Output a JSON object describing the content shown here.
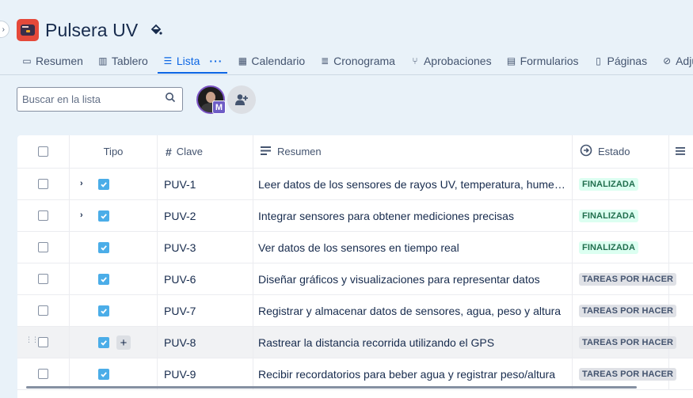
{
  "project": {
    "title": "Pulsera UV",
    "icon": "project-avatar-icon",
    "accent": "#e5493a"
  },
  "tabs": [
    {
      "label": "Resumen",
      "icon": "summary-icon",
      "active": false
    },
    {
      "label": "Tablero",
      "icon": "board-icon",
      "active": false
    },
    {
      "label": "Lista",
      "icon": "list-icon",
      "active": true
    },
    {
      "label": "Calendario",
      "icon": "calendar-icon",
      "active": false
    },
    {
      "label": "Cronograma",
      "icon": "timeline-icon",
      "active": false
    },
    {
      "label": "Aprobaciones",
      "icon": "approvals-icon",
      "active": false
    },
    {
      "label": "Formularios",
      "icon": "forms-icon",
      "active": false
    },
    {
      "label": "Páginas",
      "icon": "pages-icon",
      "active": false
    },
    {
      "label": "Adjuntos",
      "icon": "attachment-icon",
      "active": false
    }
  ],
  "search": {
    "placeholder": "Buscar en la lista",
    "value": ""
  },
  "avatar": {
    "badge": "M"
  },
  "table": {
    "headers": {
      "tipo": "Tipo",
      "clave": "Clave",
      "resumen": "Resumen",
      "estado": "Estado"
    },
    "rows": [
      {
        "key": "PUV-1",
        "summary": "Leer datos de los sensores de rayos UV, temperatura, humedad y ubicación",
        "status": "FINALIZADA",
        "status_type": "done",
        "expandable": true
      },
      {
        "key": "PUV-2",
        "summary": "Integrar sensores para obtener mediciones precisas",
        "status": "FINALIZADA",
        "status_type": "done",
        "expandable": true
      },
      {
        "key": "PUV-3",
        "summary": "Ver datos de los sensores en tiempo real",
        "status": "FINALIZADA",
        "status_type": "done",
        "expandable": false
      },
      {
        "key": "PUV-6",
        "summary": "Diseñar gráficos y visualizaciones para representar datos",
        "status": "TAREAS POR HACER",
        "status_type": "todo",
        "expandable": false
      },
      {
        "key": "PUV-7",
        "summary": "Registrar y almacenar datos de sensores, agua, peso y altura",
        "status": "TAREAS POR HACER",
        "status_type": "todo",
        "expandable": false
      },
      {
        "key": "PUV-8",
        "summary": "Rastrear la distancia recorrida utilizando el GPS",
        "status": "TAREAS POR HACER",
        "status_type": "todo",
        "expandable": false,
        "hover": true
      },
      {
        "key": "PUV-9",
        "summary": "Recibir recordatorios para beber agua y registrar peso/altura",
        "status": "TAREAS POR HACER",
        "status_type": "todo",
        "expandable": false
      }
    ]
  },
  "colors": {
    "background": "#e9f2f9",
    "link": "#0c66e4",
    "done_bg": "#dcfff1",
    "done_text": "#216e4e",
    "todo_bg": "#dfe1e6",
    "task_icon": "#4bade8"
  }
}
